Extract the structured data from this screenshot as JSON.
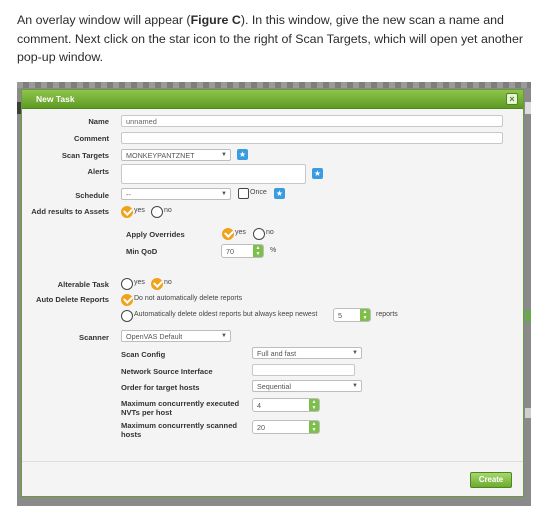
{
  "intro": {
    "part1": "An overlay window will appear (",
    "figure": "Figure C",
    "part2": "). In this window, give the new scan a name and comment. Next click on the star icon to the right of Scan Targets, which will open yet another pop-up window."
  },
  "dialog": {
    "title": "New Task",
    "close_glyph": "×",
    "name_label": "Name",
    "name_value": "unnamed",
    "comment_label": "Comment",
    "comment_value": "",
    "scan_targets_label": "Scan Targets",
    "scan_targets_value": "MONKEYPANTZNET",
    "alerts_label": "Alerts",
    "schedule_label": "Schedule",
    "schedule_value": "--",
    "schedule_once": "Once",
    "add_results_label": "Add results to Assets",
    "yes": "yes",
    "no": "no",
    "apply_overrides_label": "Apply Overrides",
    "min_qod_label": "Min QoD",
    "min_qod_value": "70",
    "min_qod_unit": "%",
    "alterable_label": "Alterable Task",
    "auto_delete_label": "Auto Delete Reports",
    "auto_delete_opt1": "Do not automatically delete reports",
    "auto_delete_opt2": "Automatically delete oldest reports but always keep newest",
    "auto_delete_count": "5",
    "auto_delete_suffix": "reports",
    "scanner_label": "Scanner",
    "scanner_value": "OpenVAS Default",
    "scan_config_label": "Scan Config",
    "scan_config_value": "Full and fast",
    "nsi_label": "Network Source Interface",
    "nsi_value": "",
    "order_label": "Order for target hosts",
    "order_value": "Sequential",
    "max_nvts_label": "Maximum concurrently executed NVTs per host",
    "max_nvts_value": "4",
    "max_hosts_label": "Maximum concurrently scanned hosts",
    "max_hosts_value": "20",
    "create_label": "Create"
  },
  "icons": {
    "star": "star-icon",
    "close": "close-icon",
    "dropdown": "chevron-down-icon"
  },
  "colors": {
    "titlebar": "#6cab2f",
    "radio_selected": "#f0a21a",
    "star_button": "#3a9be0"
  }
}
